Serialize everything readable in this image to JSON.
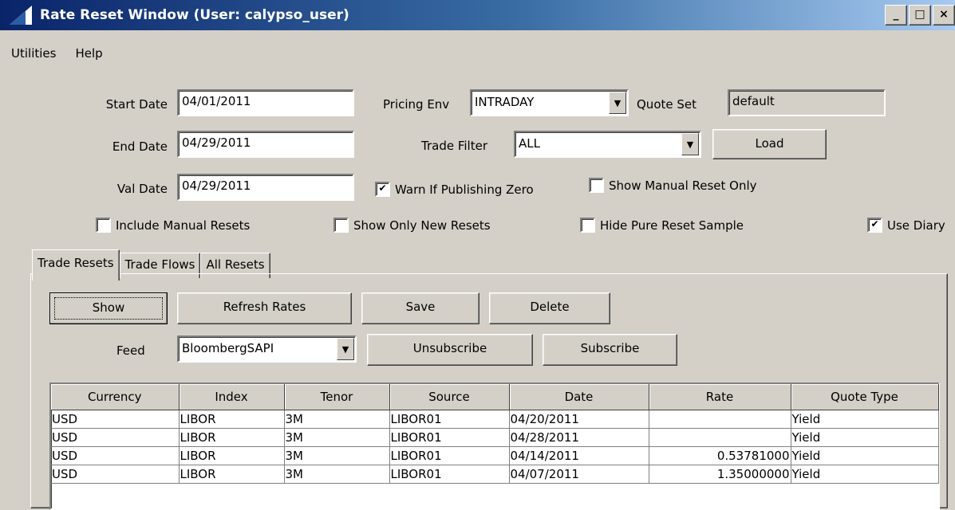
{
  "window": {
    "title": "Rate Reset Window (User: calypso_user)",
    "minimize": "_",
    "maximize": "□",
    "close": "×"
  },
  "menu": {
    "items": [
      "Utilities",
      "Help"
    ]
  },
  "form": {
    "start_date_label": "Start Date",
    "start_date": "04/01/2011",
    "end_date_label": "End Date",
    "end_date": "04/29/2011",
    "val_date_label": "Val Date",
    "val_date": "04/29/2011",
    "pricing_env_label": "Pricing Env",
    "pricing_env": "INTRADAY",
    "quote_set_label": "Quote Set",
    "quote_set": "default",
    "trade_filter_label": "Trade Filter",
    "trade_filter": "ALL",
    "load_label": "Load",
    "warn_zero": {
      "label": "Warn If Publishing Zero",
      "checked": true
    },
    "manual_only": {
      "label": "Show Manual Reset Only",
      "checked": false
    },
    "include_manual": {
      "label": "Include Manual Resets",
      "checked": false
    },
    "only_new": {
      "label": "Show Only New Resets",
      "checked": false
    },
    "hide_pure": {
      "label": "Hide Pure Reset Sample",
      "checked": false
    },
    "use_diary": {
      "label": "Use Diary",
      "checked": true
    }
  },
  "tabs": [
    "Trade Resets",
    "Trade Flows",
    "All Resets"
  ],
  "active_tab": "Trade Resets",
  "toolbar": {
    "show": "Show",
    "refresh": "Refresh Rates",
    "save": "Save",
    "delete": "Delete",
    "feed_label": "Feed",
    "feed": "BloombergSAPI",
    "unsubscribe": "Unsubscribe",
    "subscribe": "Subscribe"
  },
  "table": {
    "columns": [
      "Currency",
      "Index",
      "Tenor",
      "Source",
      "Date",
      "Rate",
      "Quote Type"
    ],
    "rows": [
      [
        "USD",
        "LIBOR",
        "3M",
        "LIBOR01",
        "04/20/2011",
        "",
        "Yield"
      ],
      [
        "USD",
        "LIBOR",
        "3M",
        "LIBOR01",
        "04/28/2011",
        "",
        "Yield"
      ],
      [
        "USD",
        "LIBOR",
        "3M",
        "LIBOR01",
        "04/14/2011",
        "0.53781000",
        "Yield"
      ],
      [
        "USD",
        "LIBOR",
        "3M",
        "LIBOR01",
        "04/07/2011",
        "1.35000000",
        "Yield"
      ]
    ]
  }
}
